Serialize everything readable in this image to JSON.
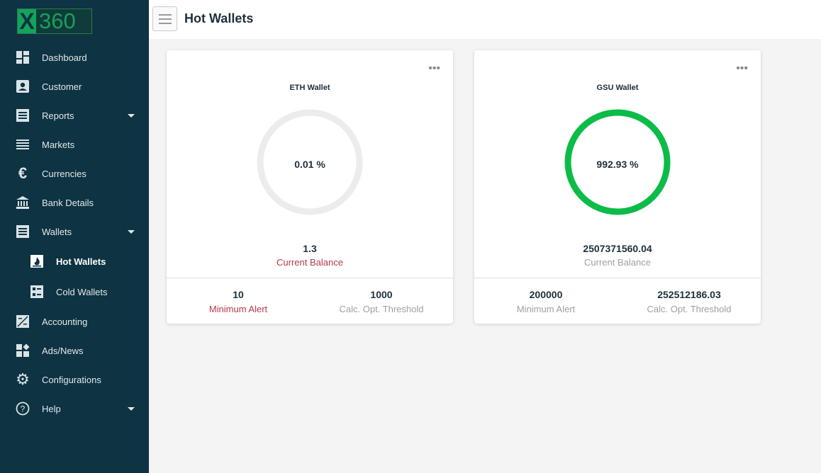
{
  "logo": {
    "x": "X",
    "num": "360"
  },
  "header": {
    "title": "Hot Wallets"
  },
  "sidebar": {
    "items": [
      {
        "label": "Dashboard",
        "icon": "dashboard-icon"
      },
      {
        "label": "Customer",
        "icon": "customer-icon"
      },
      {
        "label": "Reports",
        "icon": "reports-icon"
      },
      {
        "label": "Markets",
        "icon": "markets-icon"
      },
      {
        "label": "Currencies",
        "icon": "euro-icon"
      },
      {
        "label": "Bank Details",
        "icon": "bank-icon"
      },
      {
        "label": "Wallets",
        "icon": "wallets-icon"
      },
      {
        "label": "Hot Wallets",
        "icon": "hot-wallet-icon"
      },
      {
        "label": "Cold Wallets",
        "icon": "cold-wallet-icon"
      },
      {
        "label": "Accounting",
        "icon": "accounting-icon"
      },
      {
        "label": "Ads/News",
        "icon": "ads-icon"
      },
      {
        "label": "Configurations",
        "icon": "gear-icon"
      },
      {
        "label": "Help",
        "icon": "help-icon"
      }
    ]
  },
  "cards": [
    {
      "name": "ETH Wallet",
      "percent_label": "0.01 %",
      "percent_value": 0.01,
      "ring_color": "#ececec",
      "balance": "1.3",
      "balance_label": "Current Balance",
      "min_alert": "10",
      "min_alert_label": "Minimum Alert",
      "threshold": "1000",
      "threshold_label": "Calc. Opt. Threshold",
      "menu": "•••"
    },
    {
      "name": "GSU Wallet",
      "percent_label": "992.93 %",
      "percent_value": 992.93,
      "ring_color": "#0cbc48",
      "balance": "2507371560.04",
      "balance_label": "Current Balance",
      "min_alert": "200000",
      "min_alert_label": "Minimum Alert",
      "threshold": "252512186.03",
      "threshold_label": "Calc. Opt. Threshold",
      "menu": "•••"
    }
  ],
  "colors": {
    "sidebar": "#0e3342",
    "accent_green": "#0cbc48",
    "alert_red": "#b23a48"
  }
}
